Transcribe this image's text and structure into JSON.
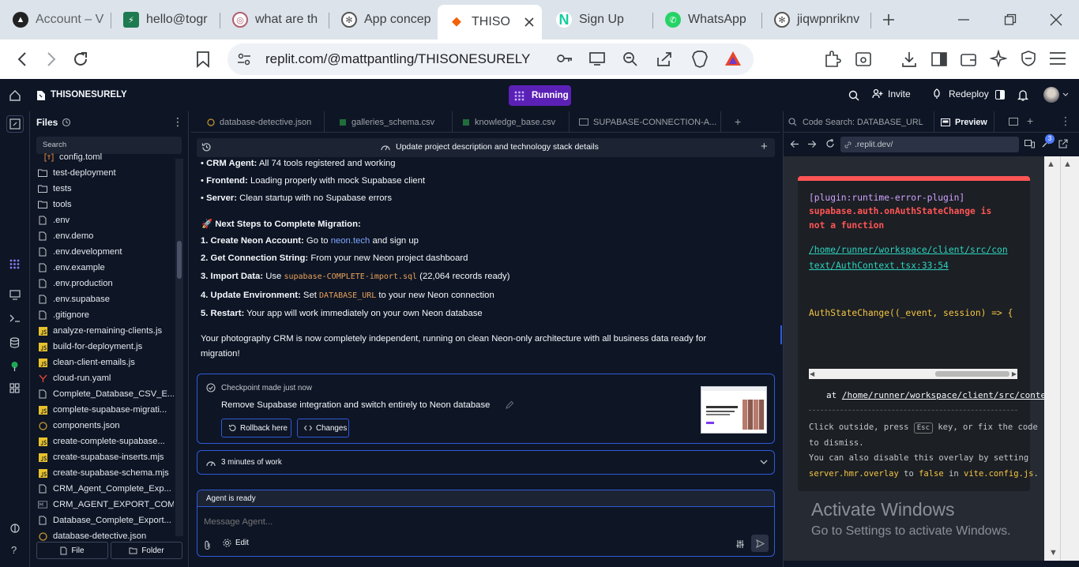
{
  "browser": {
    "tabs": [
      {
        "label": "Account – V",
        "icon": "vercel-icon"
      },
      {
        "label": "hello@togr",
        "icon": "bolt-icon"
      },
      {
        "label": "what are th",
        "icon": "brave-icon"
      },
      {
        "label": "App concep",
        "icon": "openai-icon"
      },
      {
        "label": "THISO",
        "icon": "replit-icon"
      },
      {
        "label": "Sign Up",
        "icon": "neon-icon"
      },
      {
        "label": "WhatsApp",
        "icon": "whatsapp-icon"
      },
      {
        "label": "jiqwpnriknv",
        "icon": "openai-icon"
      }
    ],
    "url": "replit.com/@mattpantling/THISONESURELY"
  },
  "replit": {
    "project_name": "THISONESURELY",
    "run_label": "Running",
    "invite_label": "Invite",
    "redeploy_label": "Redeploy"
  },
  "files": {
    "title": "Files",
    "search_label": "Search",
    "items": [
      {
        "name": "config.toml",
        "type": "toml"
      },
      {
        "name": "test-deployment",
        "type": "folder"
      },
      {
        "name": "tests",
        "type": "folder"
      },
      {
        "name": "tools",
        "type": "folder"
      },
      {
        "name": ".env",
        "type": "file"
      },
      {
        "name": ".env.demo",
        "type": "file"
      },
      {
        "name": ".env.development",
        "type": "file"
      },
      {
        "name": ".env.example",
        "type": "file"
      },
      {
        "name": ".env.production",
        "type": "file"
      },
      {
        "name": ".env.supabase",
        "type": "file"
      },
      {
        "name": ".gitignore",
        "type": "file"
      },
      {
        "name": "analyze-remaining-clients.js",
        "type": "js"
      },
      {
        "name": "build-for-deployment.js",
        "type": "js"
      },
      {
        "name": "clean-client-emails.js",
        "type": "js"
      },
      {
        "name": "cloud-run.yaml",
        "type": "yaml"
      },
      {
        "name": "Complete_Database_CSV_E...",
        "type": "file"
      },
      {
        "name": "complete-supabase-migrati...",
        "type": "js"
      },
      {
        "name": "components.json",
        "type": "json"
      },
      {
        "name": "create-complete-supabase...",
        "type": "js"
      },
      {
        "name": "create-supabase-inserts.mjs",
        "type": "js"
      },
      {
        "name": "create-supabase-schema.mjs",
        "type": "js"
      },
      {
        "name": "CRM_Agent_Complete_Exp...",
        "type": "file"
      },
      {
        "name": "CRM_AGENT_EXPORT_COM...",
        "type": "md"
      },
      {
        "name": "Database_Complete_Export...",
        "type": "file"
      },
      {
        "name": "database-detective.json",
        "type": "json"
      }
    ],
    "new_file_label": "File",
    "new_folder_label": "Folder"
  },
  "editor_tabs": [
    {
      "label": "database-detective.json",
      "icon": "json-icon"
    },
    {
      "label": "galleries_schema.csv",
      "icon": "csv-icon"
    },
    {
      "label": "knowledge_base.csv",
      "icon": "csv-icon"
    },
    {
      "label": "SUPABASE-CONNECTION-A...",
      "icon": "md-icon"
    }
  ],
  "agent": {
    "header_title": "Update project description and technology stack details",
    "bullets": [
      {
        "bold": "CRM Agent:",
        "text": " All 74 tools registered and working"
      },
      {
        "bold": "Frontend:",
        "text": " Loading properly with mock Supabase client"
      },
      {
        "bold": "Server:",
        "text": " Clean startup with no Supabase errors"
      }
    ],
    "next_steps_heading": "🚀 Next Steps to Complete Migration:",
    "steps": {
      "s1_bold": "1. Create Neon Account:",
      "s1_pre": " Go to ",
      "s1_link": "neon.tech",
      "s1_post": " and sign up",
      "s2_bold": "2. Get Connection String:",
      "s2_text": " From your new Neon project dashboard",
      "s3_bold": "3. Import Data:",
      "s3_pre": " Use ",
      "s3_code": "supabase-COMPLETE-import.sql",
      "s3_post": " (22,064 records ready)",
      "s4_bold": "4. Update Environment:",
      "s4_pre": " Set ",
      "s4_code": "DATABASE_URL",
      "s4_post": " to your new Neon connection",
      "s5_bold": "5. Restart:",
      "s5_text": " Your app will work immediately on your own Neon database"
    },
    "summary_line1": "Your photography CRM is now completely independent, running on clean Neon-only architecture with all business data ready for",
    "summary_line2": "migration!",
    "checkpoint": {
      "label": "Checkpoint made just now",
      "description": "Remove Supabase integration and switch entirely to Neon database",
      "rollback_label": "Rollback here",
      "changes_label": "Changes"
    },
    "work_label": "3 minutes of work",
    "status": "Agent is ready",
    "input_placeholder": "Message Agent...",
    "edit_label": "Edit"
  },
  "right_panel": {
    "code_search_label": "Code Search: DATABASE_URL",
    "preview_label": "Preview",
    "url": ".replit.dev/",
    "badge_count": "3",
    "error": {
      "plugin": "[plugin:runtime-error-plugin]",
      "message_line1": "supabase.auth.onAuthStateChange is",
      "message_line2": "not a function",
      "file_line1": "/home/runner/workspace/client/src/con",
      "file_line2": "text/AuthContext.tsx:33:54",
      "code_line": "AuthStateChange((_event, session) => {",
      "stack_at": "at",
      "stack_path": "/home/runner/workspace/client/src/contex",
      "tip1_pre": "Click outside, press",
      "tip1_key": "Esc",
      "tip1_post": "key, or fix the code",
      "tip2": "to dismiss.",
      "tip3": "You can also disable this overlay by setting",
      "tip4_code1": "server.hmr.overlay",
      "tip4_mid1": " to ",
      "tip4_code2": "false",
      "tip4_mid2": " in ",
      "tip4_code3": "vite.config.js",
      "tip4_end": "."
    }
  },
  "watermark": {
    "title": "Activate Windows",
    "subtitle": "Go to Settings to activate Windows."
  }
}
